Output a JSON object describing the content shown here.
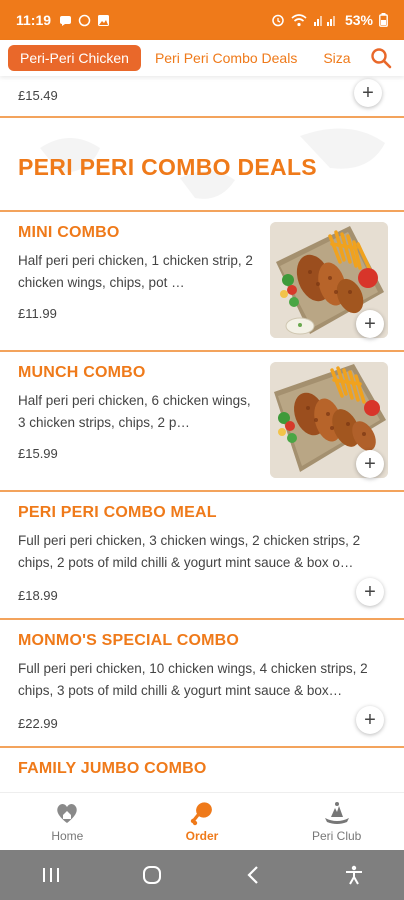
{
  "status_bar": {
    "time": "11:19",
    "battery": "53%"
  },
  "tabs": [
    {
      "label": "Peri-Peri Chicken",
      "active": true
    },
    {
      "label": "Peri Peri Combo Deals",
      "active": false
    },
    {
      "label": "Siza",
      "active": false
    }
  ],
  "previous_item": {
    "price": "£15.49"
  },
  "section": {
    "title": "PERI PERI COMBO DEALS"
  },
  "items": [
    {
      "name": "MINI COMBO",
      "description": "Half peri peri chicken, 1 chicken strip, 2 chicken wings, chips, pot …",
      "price": "£11.99",
      "add_label": "+"
    },
    {
      "name": "MUNCH COMBO",
      "description": "Half peri peri chicken, 6 chicken wings, 3 chicken strips, chips, 2 p…",
      "price": "£15.99",
      "add_label": "+"
    },
    {
      "name": "PERI PERI COMBO MEAL",
      "description": "Full peri peri chicken, 3 chicken wings, 2 chicken strips, 2 chips, 2 pots of mild chilli & yogurt mint sauce & box o…",
      "price": "£18.99",
      "add_label": "+"
    },
    {
      "name": "MONMO'S SPECIAL COMBO",
      "description": "Full peri peri chicken, 10 chicken wings, 4 chicken strips, 2 chips, 3 pots of mild chilli & yogurt mint sauce & box…",
      "price": "£22.99",
      "add_label": "+"
    },
    {
      "name": "FAMILY JUMBO COMBO"
    }
  ],
  "bottom_nav": [
    {
      "label": "Home",
      "icon": "home-heart-icon",
      "active": false
    },
    {
      "label": "Order",
      "icon": "drumstick-icon",
      "active": true
    },
    {
      "label": "Peri Club",
      "icon": "peri-club-icon",
      "active": false
    }
  ],
  "colors": {
    "accent": "#ef7a1a",
    "active_tab": "#e9682a",
    "divider": "#f3a35c",
    "system_nav": "#7f7f7f"
  }
}
